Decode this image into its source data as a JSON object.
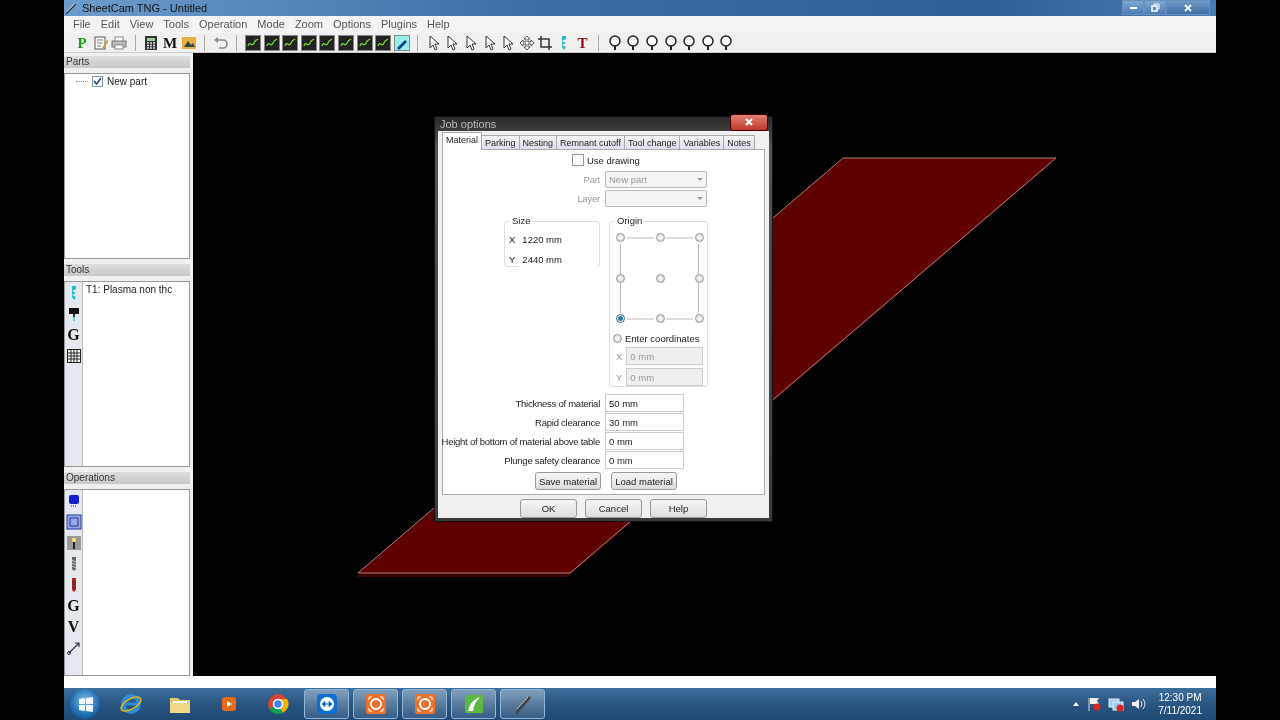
{
  "window": {
    "title": "SheetCam TNG - Untitled"
  },
  "menu": [
    "File",
    "Edit",
    "View",
    "Tools",
    "Operation",
    "Mode",
    "Zoom",
    "Options",
    "Plugins",
    "Help"
  ],
  "toolbar": [
    {
      "kind": "glyph",
      "text": "P",
      "color": "#1a9a1a"
    },
    {
      "kind": "edit"
    },
    {
      "kind": "print"
    },
    {
      "kind": "sep"
    },
    {
      "kind": "calc"
    },
    {
      "kind": "glyph",
      "text": "M",
      "color": "#111111"
    },
    {
      "kind": "image"
    },
    {
      "kind": "sep"
    },
    {
      "kind": "undo"
    },
    {
      "kind": "sep"
    },
    {
      "kind": "operation"
    },
    {
      "kind": "operation"
    },
    {
      "kind": "operation"
    },
    {
      "kind": "operation"
    },
    {
      "kind": "operation"
    },
    {
      "kind": "operation"
    },
    {
      "kind": "operation"
    },
    {
      "kind": "operation"
    },
    {
      "kind": "pen"
    },
    {
      "kind": "sep"
    },
    {
      "kind": "pointer"
    },
    {
      "kind": "pointer"
    },
    {
      "kind": "pointer"
    },
    {
      "kind": "pointer"
    },
    {
      "kind": "pointer"
    },
    {
      "kind": "move"
    },
    {
      "kind": "crop"
    },
    {
      "kind": "drill"
    },
    {
      "kind": "glyph",
      "text": "T",
      "color": "#8a1010"
    },
    {
      "kind": "sep"
    },
    {
      "kind": "zoom"
    },
    {
      "kind": "zoom"
    },
    {
      "kind": "zoom"
    },
    {
      "kind": "zoom"
    },
    {
      "kind": "zoom"
    },
    {
      "kind": "zoom"
    },
    {
      "kind": "zoom"
    }
  ],
  "parts": {
    "title": "Parts",
    "items": [
      {
        "label": "New part",
        "checked": true
      }
    ]
  },
  "tools": {
    "title": "Tools",
    "icons": [
      {
        "kind": "drill"
      },
      {
        "kind": "torch"
      },
      {
        "kind": "glyph",
        "text": "G"
      },
      {
        "kind": "grid"
      }
    ],
    "items": [
      {
        "label": "T1: Plasma non thc"
      }
    ]
  },
  "operations": {
    "title": "Operations",
    "icons": [
      {
        "kind": "chip"
      },
      {
        "kind": "profile"
      },
      {
        "kind": "light"
      },
      {
        "kind": "drill-grey"
      },
      {
        "kind": "drill-red"
      },
      {
        "kind": "glyph",
        "text": "G"
      },
      {
        "kind": "glyph",
        "text": "V"
      },
      {
        "kind": "line-arrow"
      }
    ]
  },
  "dialog": {
    "title": "Job options",
    "tabs": [
      {
        "label": "Material",
        "selected": true
      },
      {
        "label": "Parking",
        "selected": false
      },
      {
        "label": "Nesting",
        "selected": false
      },
      {
        "label": "Remnant cutoff",
        "selected": false
      },
      {
        "label": "Tool change",
        "selected": false
      },
      {
        "label": "Variables",
        "selected": false
      },
      {
        "label": "Notes",
        "selected": false
      }
    ],
    "use_drawing": {
      "label": "Use drawing",
      "checked": false
    },
    "part": {
      "label": "Part",
      "value": "New part",
      "disabled": true
    },
    "layer": {
      "label": "Layer",
      "disabled": true
    },
    "size": {
      "title": "Size",
      "fields": [
        {
          "label": "X",
          "value": "1220 mm"
        },
        {
          "label": "Y",
          "value": "2440 mm"
        }
      ]
    },
    "origin": {
      "title": "Origin",
      "points": [
        {
          "selected": false
        },
        {
          "selected": false
        },
        {
          "selected": false
        },
        {
          "selected": false
        },
        {
          "selected": false
        },
        {
          "selected": false
        },
        {
          "selected": true
        },
        {
          "selected": false
        },
        {
          "selected": false
        }
      ],
      "enter_coordinates": {
        "label": "Enter coordinates",
        "selected": false
      },
      "fields": [
        {
          "label": "X",
          "value": "0 mm",
          "disabled": true
        },
        {
          "label": "Y",
          "value": "0 mm",
          "disabled": true
        }
      ]
    },
    "fields": [
      {
        "label": "Thickness of material",
        "value": "50 mm"
      },
      {
        "label": "Rapid clearance",
        "value": "30 mm"
      },
      {
        "label": "Height of bottom of material above table",
        "value": "0 mm"
      },
      {
        "label": "Plunge safety clearance",
        "value": "0 mm"
      }
    ],
    "buttons": [
      "Save material",
      "Load material"
    ],
    "footer_buttons": [
      "OK",
      "Cancel",
      "Help"
    ]
  },
  "taskbar": {
    "apps": [
      {
        "kind": "browser-e",
        "running": false
      },
      {
        "kind": "folder",
        "running": false
      },
      {
        "kind": "media",
        "running": false
      },
      {
        "kind": "chrome",
        "running": false
      },
      {
        "kind": "remote",
        "running": true
      },
      {
        "kind": "capture",
        "running": true
      },
      {
        "kind": "capture",
        "running": true
      },
      {
        "kind": "leaf",
        "running": true
      },
      {
        "kind": "cutter",
        "running": true
      }
    ],
    "clock": {
      "time": "12:30 PM",
      "date": "7/11/2021"
    }
  }
}
